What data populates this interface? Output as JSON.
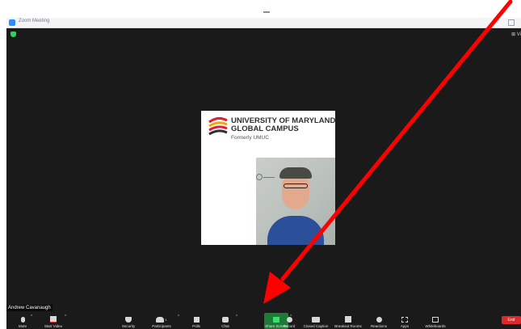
{
  "window": {
    "title": "Zoom Meeting"
  },
  "view_label": "⊞ Vi",
  "slide": {
    "title_line1": "UNIVERSITY OF MARYLAND",
    "title_line2": "GLOBAL CAMPUS",
    "subtitle": "Formerly UMUC"
  },
  "participant_name": "Andrew Cavanaugh",
  "participants_count": "1",
  "toolbar": {
    "mute": "Mute",
    "start_video": "Start Video",
    "security": "Security",
    "participants": "Participants",
    "polls": "Polls",
    "chat": "Chat",
    "share_screen": "Share Screen",
    "record": "Record",
    "closed_caption": "Closed Caption",
    "breakout_rooms": "Breakout Rooms",
    "reactions": "Reactions",
    "apps": "Apps",
    "whiteboards": "Whiteboards",
    "end": "End"
  },
  "colors": {
    "arrow": "#ff0000",
    "share_green": "#1f7a38",
    "end_red": "#e02828",
    "zoom_blue": "#2d8cff",
    "security_green": "#23d959"
  }
}
